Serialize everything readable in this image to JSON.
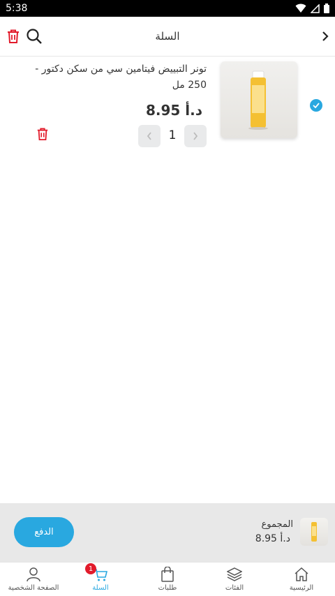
{
  "status_bar": {
    "time": "5:38"
  },
  "header": {
    "title": "السلة"
  },
  "cart": {
    "items": [
      {
        "name": "تونر التبييض فيتامين سي من سكن دكتور - 250 مل",
        "price": "د.أ 8.95",
        "quantity": "1",
        "selected": true
      }
    ]
  },
  "summary": {
    "total_label": "المجموع",
    "total_value": "د.أ 8.95",
    "pay_label": "الدفع"
  },
  "bottom_nav": {
    "items": [
      {
        "label": "الصفحة الشخصية",
        "icon": "person-icon"
      },
      {
        "label": "السلة",
        "icon": "cart-icon",
        "badge": "1",
        "active": true
      },
      {
        "label": "طلبات",
        "icon": "shopping-bag-icon"
      },
      {
        "label": "الفئات",
        "icon": "layers-icon"
      },
      {
        "label": "الرئيسية",
        "icon": "home-icon"
      }
    ]
  },
  "colors": {
    "accent": "#29a8e0",
    "danger": "#e21b2b",
    "panel": "#e8e8e8"
  }
}
